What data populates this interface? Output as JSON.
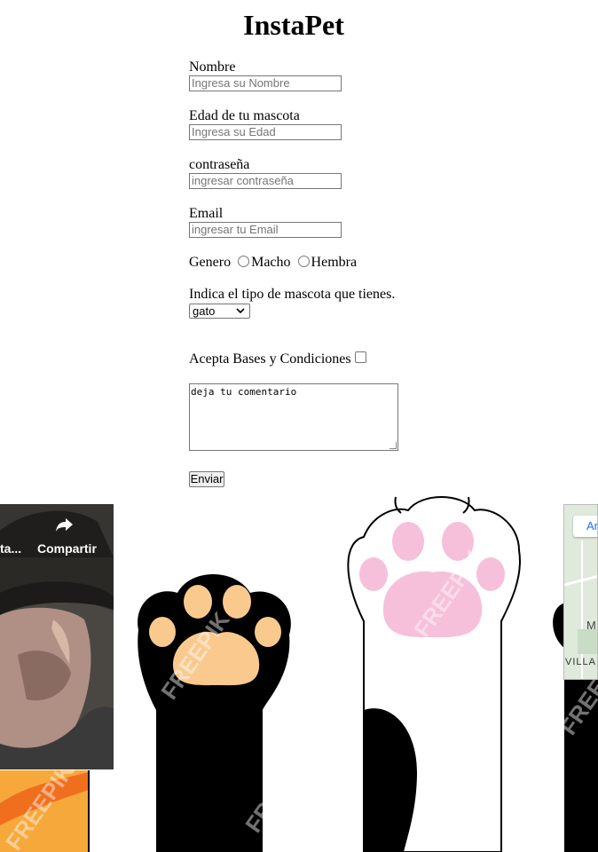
{
  "header": {
    "title": "InstaPet"
  },
  "form": {
    "nombre": {
      "label": "Nombre",
      "placeholder": "Ingresa su Nombre"
    },
    "edad": {
      "label": "Edad de tu mascota",
      "placeholder": "Ingresa su Edad"
    },
    "password": {
      "label": "contraseña",
      "placeholder": "ingresar contraseña"
    },
    "email": {
      "label": "Email",
      "placeholder": "ingresar tu Email"
    },
    "genero": {
      "label": "Genero",
      "options": [
        "Macho",
        "Hembra"
      ]
    },
    "tipo": {
      "label": "Indica el tipo de mascota que tienes.",
      "selected": "gato"
    },
    "terms": {
      "label": "Acepta Bases y Condiciones"
    },
    "comment": {
      "value": "deja tu comentario"
    },
    "submit": {
      "label": "Enviar"
    }
  },
  "video": {
    "share_label": "Compartir",
    "left_label": "ta..."
  },
  "map": {
    "chip_label": "An",
    "place_letter": "M",
    "place_label": "VILLA"
  },
  "watermark": "FREEPIK",
  "colors": {
    "paw_tan": "#f9c98e",
    "paw_pink": "#f6c0da",
    "paw_black": "#000000",
    "map_bg": "#dfeadc",
    "link_blue": "#1a73e8"
  },
  "icons": [
    "share-icon",
    "chevron-down-icon"
  ]
}
